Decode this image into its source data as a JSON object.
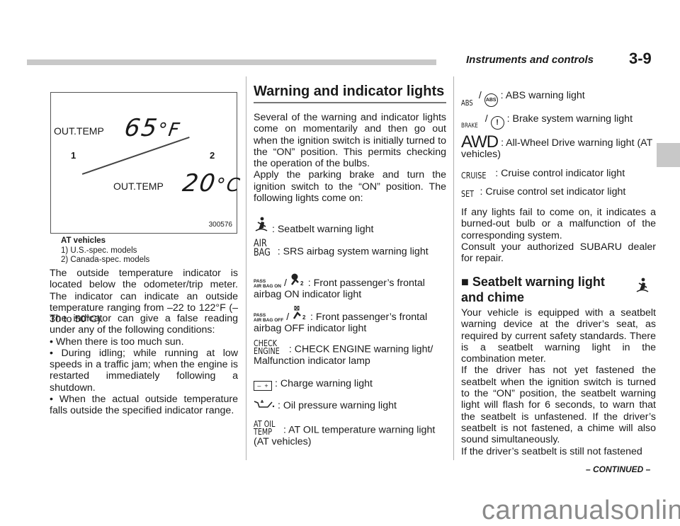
{
  "header": {
    "title": "Instruments and controls",
    "page": "3-9"
  },
  "figure": {
    "label_top": "OUT.TEMP",
    "reading_f": "65",
    "unit_f": "°F",
    "label_bottom": "OUT.TEMP",
    "reading_c": "20",
    "unit_c": "°C",
    "callout_1": "1",
    "callout_2": "2",
    "figure_id": "300576"
  },
  "caption": {
    "title": "AT vehicles",
    "items": [
      "1)  U.S.-spec. models",
      "2)  Canada-spec. models"
    ]
  },
  "column1": {
    "para1": "The outside temperature indicator is located below the odometer/trip meter. The indicator can indicate an outside temperature ranging from –22 to 122°F (–30 to 50°C).",
    "para2": "The indicator can give a false reading under any of the following conditions:",
    "bullets": [
      "When there is too much sun.",
      "During idling; while running at low speeds in a traffic jam; when the engine is restarted immediately following a shutdown.",
      "When the actual outside temperature falls outside the specified indicator range."
    ]
  },
  "column2": {
    "section_title": "Warning and indicator lights",
    "intro1": "Several of the warning and indicator lights come on momentarily and then go out when the ignition switch is initially turned to the “ON” position. This permits checking the operation of the bulbs.",
    "intro2": "Apply the parking brake and turn the ignition switch to the “ON” position. The following lights come on:",
    "lights": [
      {
        "icon": "seatbelt-icon",
        "text": ": Seatbelt warning light"
      },
      {
        "icon": "airbag-icon",
        "icon_text": [
          "AIR",
          "BAG"
        ],
        "text": ": SRS airbag system warning light"
      },
      {
        "icon": "passenger-airbag-on-icon",
        "icon_text": [
          "PASS",
          "AIR BAG ON"
        ],
        "text": ": Front passenger’s frontal airbag ON indicator light"
      },
      {
        "icon": "passenger-airbag-off-icon",
        "icon_text": [
          "PASS",
          "AIR BAG OFF"
        ],
        "text": ": Front passenger’s frontal airbag OFF indicator light"
      },
      {
        "icon": "check-engine-icon",
        "icon_text": [
          "CHECK",
          "ENGINE"
        ],
        "text": ": CHECK ENGINE warning light/ Malfunction indicator lamp"
      },
      {
        "icon": "battery-icon",
        "text": ": Charge warning light"
      },
      {
        "icon": "oil-can-icon",
        "text": ": Oil pressure warning light"
      },
      {
        "icon": "at-oil-temp-icon",
        "icon_text": [
          "AT OIL",
          "TEMP"
        ],
        "text": ": AT OIL temperature warning light (AT vehicles)"
      }
    ]
  },
  "column3": {
    "lights": [
      {
        "icon": "abs-icon",
        "icon_text": "ABS",
        "circle_text": "ABS",
        "text": ": ABS warning light"
      },
      {
        "icon": "brake-icon",
        "icon_text": "BRAKE",
        "circle_text": "!",
        "text": ": Brake system warning light"
      },
      {
        "icon": "awd-icon",
        "icon_text": "AWD",
        "text": ": All-Wheel Drive warning light (AT vehicles)"
      },
      {
        "icon": "cruise-icon",
        "icon_text": "CRUISE",
        "text": ": Cruise control indicator light"
      },
      {
        "icon": "set-icon",
        "icon_text": "SET",
        "text": ": Cruise control set indicator light"
      }
    ],
    "para1": "If any lights fail to come on, it indicates a burned-out bulb or a malfunction of the corresponding system.",
    "para2": "Consult your authorized SUBARU dealer for repair.",
    "subsection_marker": "■",
    "subsection_title": "Seatbelt warning light and chime",
    "para3": "Your vehicle is equipped with a seatbelt warning device at the driver’s seat, as required by current safety standards. There is a seatbelt warning light in the combination meter.",
    "para4": "If the driver has not yet fastened the seatbelt when the ignition switch is turned to the “ON” position, the seatbelt warning light will flash for 6 seconds, to warn that the seatbelt is unfastened. If the driver’s seatbelt is not fastened, a chime will also sound simultaneously.",
    "para5": "If the driver’s seatbelt is still not fastened"
  },
  "footer": {
    "continued": "– CONTINUED –",
    "watermark": "carmanualsonline.info"
  }
}
